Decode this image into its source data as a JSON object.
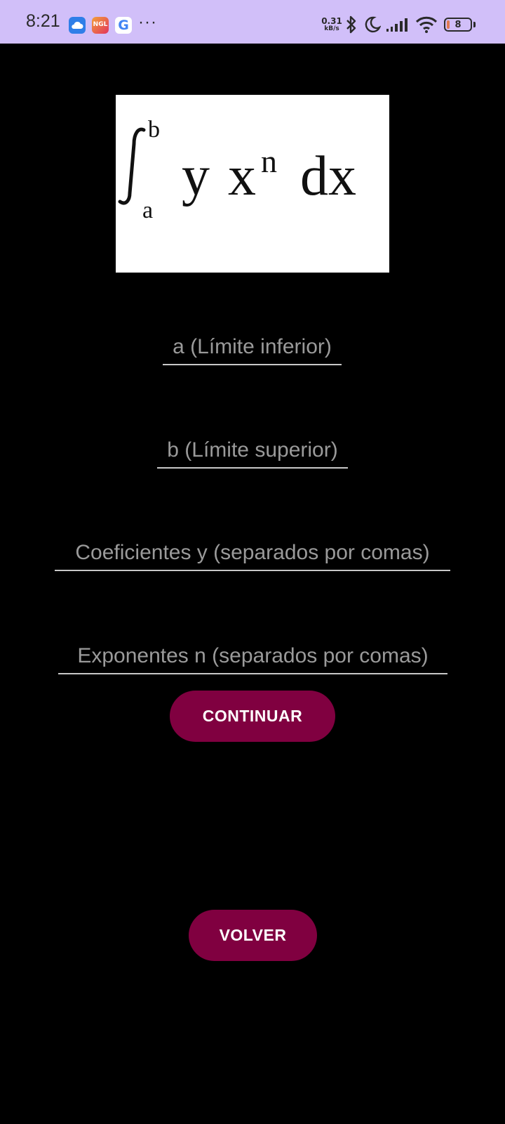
{
  "status_bar": {
    "time": "8:21",
    "notification_icons": [
      "weather-cloud-icon",
      "ngl-app-icon",
      "google-icon"
    ],
    "ngl_label": "NGL",
    "google_label": "G",
    "more_indicator": "···",
    "net_speed_value": "0.31",
    "net_speed_unit": "kB/s",
    "battery_level": "8",
    "background_color": "#d1bff9"
  },
  "formula": {
    "upper_limit": "b",
    "lower_limit": "a",
    "coefficient": "y",
    "base": "x",
    "exponent": "n",
    "differential": "dx"
  },
  "form": {
    "lower_limit_placeholder": "a (Límite inferior)",
    "upper_limit_placeholder": "b (Límite superior)",
    "coefficients_placeholder": "Coeficientes y (separados por comas)",
    "exponents_placeholder": "Exponentes n (separados por comas)"
  },
  "buttons": {
    "continue_label": "CONTINUAR",
    "back_label": "VOLVER",
    "color": "#800040"
  }
}
